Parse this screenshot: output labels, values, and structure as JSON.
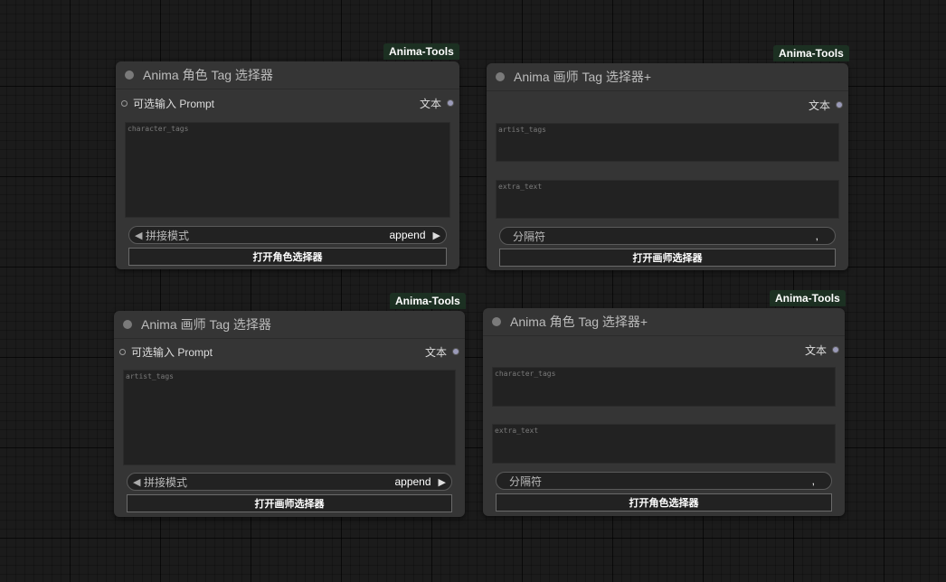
{
  "nodes": [
    {
      "badge": "Anima-Tools",
      "title": "Anima 角色 Tag 选择器",
      "input_label": "可选输入 Prompt",
      "output_label": "文本",
      "textarea_placeholder": "character_tags",
      "combo_label": "拼接模式",
      "combo_value": "append",
      "button_label": "打开角色选择器"
    },
    {
      "badge": "Anima-Tools",
      "title": "Anima 画师 Tag 选择器+",
      "output_label": "文本",
      "textarea1_placeholder": "artist_tags",
      "textarea2_placeholder": "extra_text",
      "separator_label": "分隔符",
      "separator_value": ",",
      "button_label": "打开画师选择器"
    },
    {
      "badge": "Anima-Tools",
      "title": "Anima 画师 Tag 选择器",
      "input_label": "可选输入 Prompt",
      "output_label": "文本",
      "textarea_placeholder": "artist_tags",
      "combo_label": "拼接模式",
      "combo_value": "append",
      "button_label": "打开画师选择器"
    },
    {
      "badge": "Anima-Tools",
      "title": "Anima 角色 Tag 选择器+",
      "output_label": "文本",
      "textarea1_placeholder": "character_tags",
      "textarea2_placeholder": "extra_text",
      "separator_label": "分隔符",
      "separator_value": ",",
      "button_label": "打开角色选择器"
    }
  ],
  "colors": {
    "canvas": "#1b1b1b",
    "node_body": "#353535",
    "badge_bg": "#1c3022",
    "widget_bg": "#222222"
  }
}
